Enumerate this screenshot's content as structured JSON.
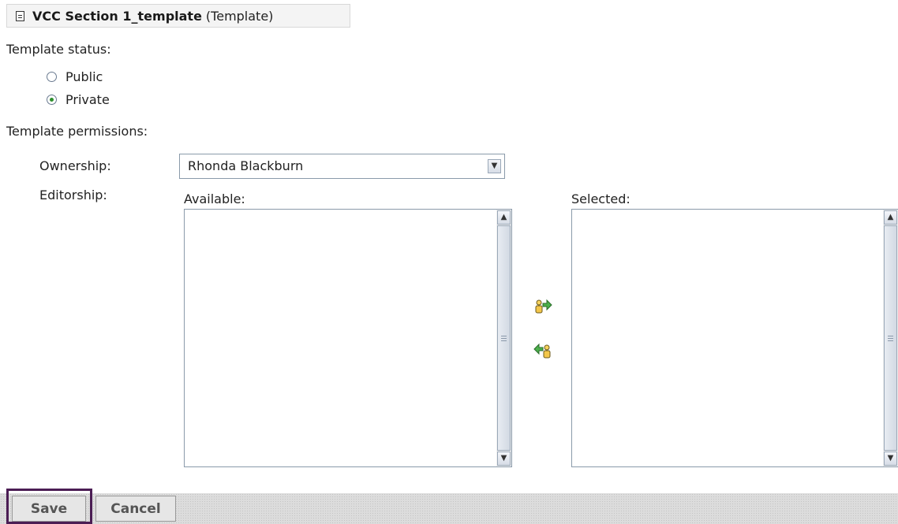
{
  "header": {
    "title": "VCC Section 1_template",
    "type": "(Template)",
    "icon": "document-icon"
  },
  "status": {
    "label": "Template status:",
    "options": [
      {
        "label": "Public",
        "selected": false
      },
      {
        "label": "Private",
        "selected": true
      }
    ]
  },
  "permissions": {
    "label": "Template permissions:",
    "ownership_label": "Ownership:",
    "ownership_value": "Rhonda Blackburn",
    "editorship_label": "Editorship:",
    "available_label": "Available:",
    "selected_label": "Selected:",
    "available_items": [],
    "selected_items": []
  },
  "actions": {
    "save_label": "Save",
    "cancel_label": "Cancel"
  },
  "colors": {
    "focus_outline": "#4b1d54",
    "radio_selected": "#2e8f2e"
  }
}
